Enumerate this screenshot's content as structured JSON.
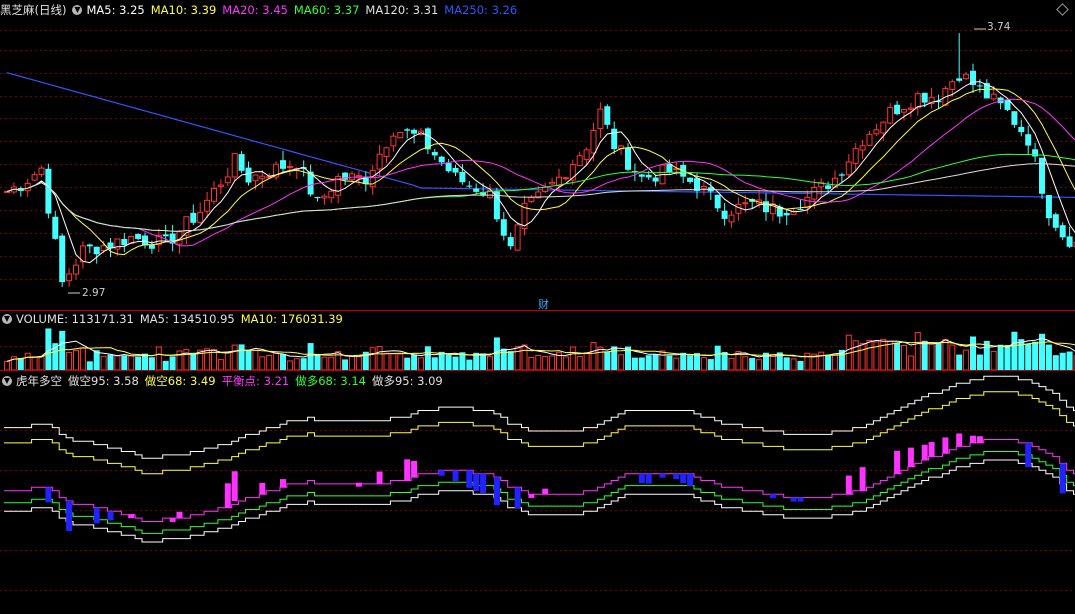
{
  "stock_title": "黑芝麻(日线)",
  "price_panel": {
    "ma_labels": [
      {
        "text": "MA5: 3.25",
        "color": "#ffffff"
      },
      {
        "text": "MA10: 3.39",
        "color": "#ffff44"
      },
      {
        "text": "MA20: 3.45",
        "color": "#ff33ff"
      },
      {
        "text": "MA60: 3.37",
        "color": "#33ff33"
      },
      {
        "text": "MA120: 3.31",
        "color": "#e0e0e0"
      },
      {
        "text": "MA250: 3.26",
        "color": "#3355ff"
      }
    ],
    "high_label": "3.74",
    "low_label": "2.97",
    "news_marker": "财",
    "colors": {
      "up": "#ff3333",
      "down": "#44ffff"
    }
  },
  "volume_panel": {
    "labels": [
      {
        "text": "VOLUME: 113171.31",
        "color": "#e0e0e0"
      },
      {
        "text": "MA5: 134510.95",
        "color": "#e0e0e0"
      },
      {
        "text": "MA10: 176031.39",
        "color": "#ffff44"
      }
    ]
  },
  "indicator_panel": {
    "labels": [
      {
        "text": "虎年多空",
        "color": "#e0e0e0"
      },
      {
        "text": "做空95: 3.58",
        "color": "#e0e0e0"
      },
      {
        "text": "做空68: 3.49",
        "color": "#ffff44"
      },
      {
        "text": "平衡点: 3.21",
        "color": "#ff33ff"
      },
      {
        "text": "做多68: 3.14",
        "color": "#33ff33"
      },
      {
        "text": "做多95: 3.09",
        "color": "#e0e0e0"
      }
    ]
  },
  "chart_data": {
    "type": "candlestick",
    "price_anchors": [
      [
        0,
        3.26
      ],
      [
        2,
        3.28
      ],
      [
        5,
        3.33
      ],
      [
        8,
        2.98
      ],
      [
        11,
        3.08
      ],
      [
        15,
        3.1
      ],
      [
        18,
        3.12
      ],
      [
        23,
        3.1
      ],
      [
        28,
        3.2
      ],
      [
        33,
        3.35
      ],
      [
        35,
        3.3
      ],
      [
        42,
        3.35
      ],
      [
        45,
        3.22
      ],
      [
        48,
        3.3
      ],
      [
        52,
        3.3
      ],
      [
        56,
        3.45
      ],
      [
        60,
        3.42
      ],
      [
        65,
        3.3
      ],
      [
        70,
        3.25
      ],
      [
        73,
        3.08
      ],
      [
        75,
        3.2
      ],
      [
        80,
        3.3
      ],
      [
        84,
        3.4
      ],
      [
        86,
        3.5
      ],
      [
        88,
        3.4
      ],
      [
        92,
        3.3
      ],
      [
        96,
        3.32
      ],
      [
        100,
        3.28
      ],
      [
        104,
        3.2
      ],
      [
        108,
        3.22
      ],
      [
        112,
        3.2
      ],
      [
        116,
        3.24
      ],
      [
        120,
        3.3
      ],
      [
        124,
        3.42
      ],
      [
        128,
        3.5
      ],
      [
        132,
        3.55
      ],
      [
        135,
        3.55
      ],
      [
        138,
        3.62
      ],
      [
        142,
        3.55
      ],
      [
        145,
        3.5
      ],
      [
        148,
        3.42
      ],
      [
        151,
        3.2
      ],
      [
        153,
        3.13
      ],
      [
        155,
        3.1
      ]
    ],
    "high": 3.74,
    "low": 2.97,
    "ylim": [
      2.93,
      3.78
    ],
    "volume_ylim": [
      0,
      360000
    ],
    "indicator_ylim": [
      2.55,
      3.85
    ],
    "indicator_offsets": {
      "short95": 0.37,
      "short68": 0.28,
      "balance": 0,
      "long68": -0.07,
      "long95": -0.12
    },
    "indicator_last": {
      "short95": 3.58,
      "short68": 3.49,
      "balance": 3.21,
      "long68": 3.14,
      "long95": 3.09
    }
  }
}
